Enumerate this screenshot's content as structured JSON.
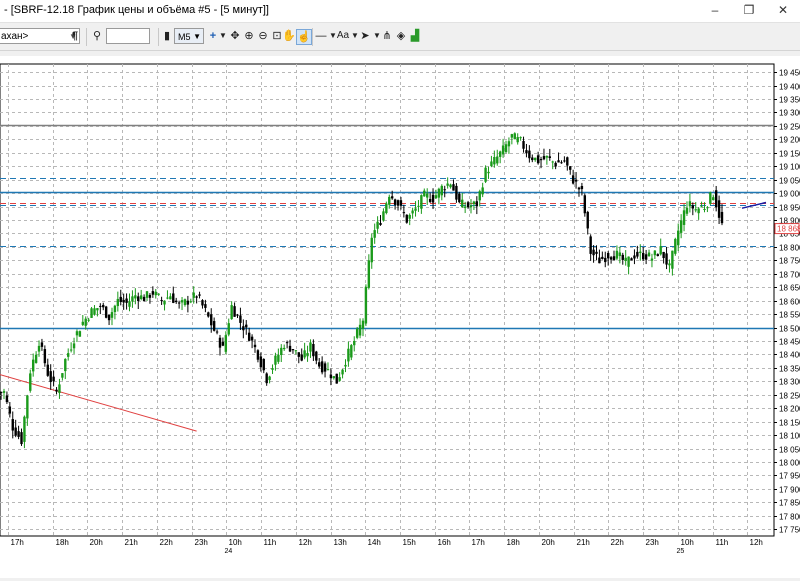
{
  "window": {
    "title": "- [SBRF-12.18 График цены и объёма #5 - [5 минут]]",
    "minimize": "–",
    "maximize": "❐",
    "close": "✕"
  },
  "toolbar": {
    "instrument_combo": "ахан>",
    "timeframe": "M5",
    "search_value": "",
    "text_tool": "Aa"
  },
  "chart_data": {
    "type": "candlestick",
    "instrument": "SBRF-12.18",
    "timeframe": "5 минут",
    "ylim": [
      17725,
      19480
    ],
    "y_ticks": [
      "19 450",
      "19 400",
      "19 350",
      "19 300",
      "19 250",
      "19 200",
      "19 150",
      "19 100",
      "19 050",
      "19 000",
      "18 950",
      "18 900",
      "18 850",
      "18 800",
      "18 750",
      "18 700",
      "18 650",
      "18 600",
      "18 550",
      "18 500",
      "18 450",
      "18 400",
      "18 350",
      "18 300",
      "18 250",
      "18 200",
      "18 150",
      "18 100",
      "18 050",
      "18 000",
      "17 950",
      "17 900",
      "17 850",
      "17 800",
      "17 750"
    ],
    "x_ticks": [
      "17h",
      "18h",
      "20h",
      "21h",
      "22h",
      "23h",
      "10h",
      "11h",
      "12h",
      "13h",
      "14h",
      "15h",
      "16h",
      "17h",
      "18h",
      "20h",
      "21h",
      "22h",
      "23h",
      "10h",
      "11h",
      "12h"
    ],
    "date_markers": [
      "24",
      "25"
    ],
    "current_price": "18 868",
    "levels": [
      {
        "price": 19255,
        "style": "solid",
        "color": "#808080"
      },
      {
        "price": 19055,
        "style": "dashed",
        "color": "#1f78b4"
      },
      {
        "price": 19005,
        "style": "solid",
        "color": "#1f78b4"
      },
      {
        "price": 18965,
        "style": "dashed",
        "color": "#e04040"
      },
      {
        "price": 18955,
        "style": "dashed",
        "color": "#1f78b4"
      },
      {
        "price": 18805,
        "style": "dashed",
        "color": "#1f78b4"
      },
      {
        "price": 18500,
        "style": "solid",
        "color": "#1f78b4"
      }
    ],
    "trendline": {
      "from": [
        "17h",
        18325
      ],
      "to": [
        "23h",
        18115
      ],
      "color": "#e04040"
    },
    "path": [
      18260,
      18130,
      18080,
      18340,
      18450,
      18330,
      18260,
      18380,
      18460,
      18520,
      18560,
      18580,
      18540,
      18600,
      18590,
      18620,
      18610,
      18630,
      18600,
      18620,
      18580,
      18600,
      18620,
      18560,
      18490,
      18420,
      18580,
      18520,
      18470,
      18400,
      18310,
      18380,
      18440,
      18420,
      18380,
      18430,
      18360,
      18340,
      18300,
      18380,
      18450,
      18530,
      18840,
      18900,
      19000,
      18960,
      18900,
      18940,
      18990,
      18980,
      19020,
      19040,
      18960,
      18950,
      18960,
      19080,
      19120,
      19160,
      19210,
      19190,
      19140,
      19120,
      19130,
      19110,
      19120,
      19050,
      19000,
      18780,
      18750,
      18770,
      18770,
      18740,
      18770,
      18770,
      18760,
      18790,
      18720,
      18860,
      18960,
      18940,
      18950,
      19000,
      18880
    ]
  }
}
